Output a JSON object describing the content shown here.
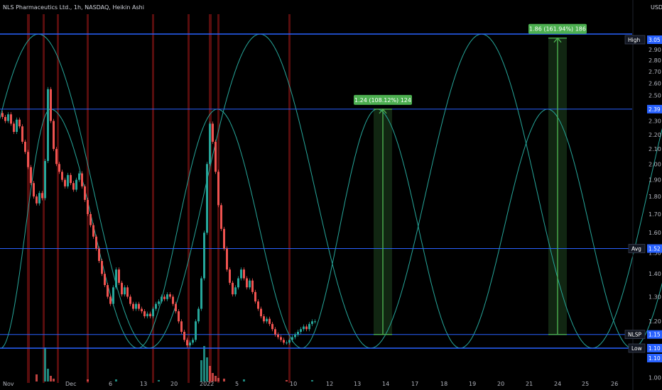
{
  "header": {
    "title": "NLS Pharmaceutics Ltd., 1h, NASDAQ, Heikin Ashi",
    "currency": "USD"
  },
  "colors": {
    "background": "#000000",
    "axis_text": "#b2b5be",
    "level_line": "#2962ff",
    "wave": "#26a69a",
    "up_candle": "#26a69a",
    "down_candle": "#ef5350",
    "measure": "#4caf50",
    "volume_up": "#26a69a",
    "volume_down": "#ef5350",
    "session_band": "#a01818"
  },
  "chart_data": {
    "type": "candlestick",
    "chart_style": "Heikin Ashi",
    "interval": "1h",
    "exchange": "NASDAQ",
    "y_scale": "log",
    "ylim": [
      0.98,
      3.3
    ],
    "y_ticks": [
      1.0,
      1.1,
      1.2,
      1.3,
      1.4,
      1.5,
      1.6,
      1.7,
      1.8,
      1.9,
      2.0,
      2.1,
      2.2,
      2.3,
      2.4,
      2.5,
      2.6,
      2.7,
      2.8,
      2.9,
      3.0,
      3.05
    ],
    "y_tick_labels": [
      "1.00",
      "1.10",
      "1.20",
      "1.30",
      "1.40",
      "1.50",
      "1.60",
      "1.70",
      "1.80",
      "1.90",
      "2.00",
      "2.10",
      "2.20",
      "2.30",
      "2.40",
      "2.50",
      "2.60",
      "2.70",
      "2.80",
      "2.90",
      "3.00",
      "3.05"
    ],
    "x_ticks": [
      {
        "label": "Nov",
        "bar": 0
      },
      {
        "label": "Dec",
        "bar": 88
      },
      {
        "label": "6",
        "bar": 149
      },
      {
        "label": "13",
        "bar": 193
      },
      {
        "label": "20",
        "bar": 236
      },
      {
        "label": "2022",
        "bar": 277
      },
      {
        "label": "5",
        "bar": 327
      },
      {
        "label": "10",
        "bar": 404
      },
      {
        "label": "12",
        "bar": 455
      },
      {
        "label": "13",
        "bar": 494
      },
      {
        "label": "14",
        "bar": 534
      },
      {
        "label": "17",
        "bar": 575
      },
      {
        "label": "18",
        "bar": 616
      },
      {
        "label": "19",
        "bar": 656
      },
      {
        "label": "20",
        "bar": 696
      },
      {
        "label": "21",
        "bar": 736
      },
      {
        "label": "24",
        "bar": 776
      },
      {
        "label": "25",
        "bar": 815
      },
      {
        "label": "26",
        "bar": 856
      }
    ],
    "last_bar": 440,
    "horizontal_levels": [
      {
        "label": "High",
        "value": 3.05,
        "price_label": "3.05"
      },
      {
        "label": "",
        "value": 2.39,
        "price_label": "2.39"
      },
      {
        "label": "Avg",
        "value": 1.52,
        "price_label": "1.52"
      },
      {
        "label": "NLSP",
        "value": 1.15,
        "price_label": "1.15"
      },
      {
        "label": "Low",
        "value": 1.1,
        "price_label": "1.10"
      },
      {
        "label": "",
        "value": 1.1,
        "price_label": "1.10"
      }
    ],
    "price_range_measures": [
      {
        "text": "1.24 (108.12%) 124",
        "from_value": 1.15,
        "to_value": 2.39,
        "bar_start": 524,
        "bar_end": 550
      },
      {
        "text": "1.86 (161.94%) 186",
        "from_value": 1.15,
        "to_value": 3.01,
        "bar_start": 770,
        "bar_end": 796
      }
    ],
    "cycle_waves": [
      {
        "name": "",
        "peak_bars": [
          -260,
          52,
          364,
          676,
          988
        ],
        "trough_bars": [
          -104,
          208,
          520,
          832
        ],
        "peak_value": 3.05,
        "trough_value": 1.1
      },
      {
        "name": "",
        "peak_bars": [
          -116,
          69,
          304,
          529,
          769,
          1009
        ],
        "trough_bars": [
          -1,
          192,
          423,
          646,
          888
        ],
        "peak_value": 2.39,
        "trough_value": 1.1
      }
    ],
    "candles": [
      {
        "bar": 0,
        "open": 2.36,
        "close": 2.33
      },
      {
        "bar": 4,
        "open": 2.33,
        "close": 2.3
      },
      {
        "bar": 8,
        "open": 2.3,
        "close": 2.35
      },
      {
        "bar": 12,
        "open": 2.35,
        "close": 2.28
      },
      {
        "bar": 16,
        "open": 2.28,
        "close": 2.22
      },
      {
        "bar": 20,
        "open": 2.22,
        "close": 2.31
      },
      {
        "bar": 24,
        "open": 2.31,
        "close": 2.26
      },
      {
        "bar": 28,
        "open": 2.26,
        "close": 2.15
      },
      {
        "bar": 32,
        "open": 2.15,
        "close": 2.08
      },
      {
        "bar": 36,
        "open": 2.08,
        "close": 1.98
      },
      {
        "bar": 40,
        "open": 1.98,
        "close": 1.88
      },
      {
        "bar": 44,
        "open": 1.88,
        "close": 1.8
      },
      {
        "bar": 48,
        "open": 1.8,
        "close": 1.76
      },
      {
        "bar": 52,
        "open": 1.76,
        "close": 1.82
      },
      {
        "bar": 56,
        "open": 1.82,
        "close": 1.79
      },
      {
        "bar": 60,
        "open": 1.79,
        "close": 2.02
      },
      {
        "bar": 64,
        "open": 2.02,
        "close": 2.55
      },
      {
        "bar": 68,
        "open": 2.55,
        "close": 2.3
      },
      {
        "bar": 72,
        "open": 2.3,
        "close": 2.1
      },
      {
        "bar": 76,
        "open": 2.1,
        "close": 2.0
      },
      {
        "bar": 80,
        "open": 2.0,
        "close": 1.95
      },
      {
        "bar": 84,
        "open": 1.95,
        "close": 1.9
      },
      {
        "bar": 88,
        "open": 1.9,
        "close": 1.86
      },
      {
        "bar": 92,
        "open": 1.86,
        "close": 1.93
      },
      {
        "bar": 96,
        "open": 1.93,
        "close": 1.88
      },
      {
        "bar": 100,
        "open": 1.88,
        "close": 1.84
      },
      {
        "bar": 104,
        "open": 1.84,
        "close": 1.9
      },
      {
        "bar": 108,
        "open": 1.9,
        "close": 1.94
      },
      {
        "bar": 112,
        "open": 1.94,
        "close": 1.86
      },
      {
        "bar": 116,
        "open": 1.86,
        "close": 1.78
      },
      {
        "bar": 120,
        "open": 1.78,
        "close": 1.7
      },
      {
        "bar": 124,
        "open": 1.7,
        "close": 1.64
      },
      {
        "bar": 128,
        "open": 1.64,
        "close": 1.58
      },
      {
        "bar": 132,
        "open": 1.58,
        "close": 1.52
      },
      {
        "bar": 136,
        "open": 1.52,
        "close": 1.46
      },
      {
        "bar": 140,
        "open": 1.46,
        "close": 1.4
      },
      {
        "bar": 144,
        "open": 1.4,
        "close": 1.35
      },
      {
        "bar": 148,
        "open": 1.35,
        "close": 1.3
      },
      {
        "bar": 152,
        "open": 1.3,
        "close": 1.27
      },
      {
        "bar": 156,
        "open": 1.27,
        "close": 1.34
      },
      {
        "bar": 160,
        "open": 1.34,
        "close": 1.42
      },
      {
        "bar": 164,
        "open": 1.42,
        "close": 1.36
      },
      {
        "bar": 168,
        "open": 1.36,
        "close": 1.31
      },
      {
        "bar": 172,
        "open": 1.31,
        "close": 1.34
      },
      {
        "bar": 176,
        "open": 1.34,
        "close": 1.3
      },
      {
        "bar": 180,
        "open": 1.3,
        "close": 1.27
      },
      {
        "bar": 184,
        "open": 1.27,
        "close": 1.25
      },
      {
        "bar": 188,
        "open": 1.25,
        "close": 1.27
      },
      {
        "bar": 192,
        "open": 1.27,
        "close": 1.25
      },
      {
        "bar": 196,
        "open": 1.25,
        "close": 1.24
      },
      {
        "bar": 200,
        "open": 1.24,
        "close": 1.22
      },
      {
        "bar": 204,
        "open": 1.22,
        "close": 1.23
      },
      {
        "bar": 208,
        "open": 1.23,
        "close": 1.22
      },
      {
        "bar": 212,
        "open": 1.22,
        "close": 1.25
      },
      {
        "bar": 216,
        "open": 1.25,
        "close": 1.27
      },
      {
        "bar": 220,
        "open": 1.27,
        "close": 1.28
      },
      {
        "bar": 224,
        "open": 1.28,
        "close": 1.3
      },
      {
        "bar": 228,
        "open": 1.3,
        "close": 1.29
      },
      {
        "bar": 232,
        "open": 1.29,
        "close": 1.31
      },
      {
        "bar": 236,
        "open": 1.31,
        "close": 1.3
      },
      {
        "bar": 240,
        "open": 1.3,
        "close": 1.27
      },
      {
        "bar": 244,
        "open": 1.27,
        "close": 1.24
      },
      {
        "bar": 248,
        "open": 1.24,
        "close": 1.2
      },
      {
        "bar": 252,
        "open": 1.2,
        "close": 1.16
      },
      {
        "bar": 256,
        "open": 1.16,
        "close": 1.13
      },
      {
        "bar": 260,
        "open": 1.13,
        "close": 1.11
      },
      {
        "bar": 264,
        "open": 1.11,
        "close": 1.12
      },
      {
        "bar": 268,
        "open": 1.12,
        "close": 1.13
      },
      {
        "bar": 272,
        "open": 1.13,
        "close": 1.2
      },
      {
        "bar": 276,
        "open": 1.2,
        "close": 1.25
      },
      {
        "bar": 280,
        "open": 1.25,
        "close": 1.38
      },
      {
        "bar": 284,
        "open": 1.38,
        "close": 1.6
      },
      {
        "bar": 288,
        "open": 1.6,
        "close": 2.0
      },
      {
        "bar": 292,
        "open": 2.0,
        "close": 2.28
      },
      {
        "bar": 296,
        "open": 2.28,
        "close": 2.15
      },
      {
        "bar": 300,
        "open": 2.15,
        "close": 1.95
      },
      {
        "bar": 304,
        "open": 1.95,
        "close": 1.75
      },
      {
        "bar": 308,
        "open": 1.75,
        "close": 1.62
      },
      {
        "bar": 312,
        "open": 1.62,
        "close": 1.52
      },
      {
        "bar": 316,
        "open": 1.52,
        "close": 1.42
      },
      {
        "bar": 320,
        "open": 1.42,
        "close": 1.36
      },
      {
        "bar": 324,
        "open": 1.36,
        "close": 1.31
      },
      {
        "bar": 328,
        "open": 1.31,
        "close": 1.34
      },
      {
        "bar": 332,
        "open": 1.34,
        "close": 1.38
      },
      {
        "bar": 336,
        "open": 1.38,
        "close": 1.42
      },
      {
        "bar": 340,
        "open": 1.42,
        "close": 1.38
      },
      {
        "bar": 344,
        "open": 1.38,
        "close": 1.34
      },
      {
        "bar": 348,
        "open": 1.34,
        "close": 1.37
      },
      {
        "bar": 352,
        "open": 1.37,
        "close": 1.32
      },
      {
        "bar": 356,
        "open": 1.32,
        "close": 1.28
      },
      {
        "bar": 360,
        "open": 1.28,
        "close": 1.25
      },
      {
        "bar": 364,
        "open": 1.25,
        "close": 1.22
      },
      {
        "bar": 368,
        "open": 1.22,
        "close": 1.2
      },
      {
        "bar": 372,
        "open": 1.2,
        "close": 1.21
      },
      {
        "bar": 376,
        "open": 1.21,
        "close": 1.19
      },
      {
        "bar": 380,
        "open": 1.19,
        "close": 1.17
      },
      {
        "bar": 384,
        "open": 1.17,
        "close": 1.15
      },
      {
        "bar": 388,
        "open": 1.15,
        "close": 1.14
      },
      {
        "bar": 392,
        "open": 1.14,
        "close": 1.13
      },
      {
        "bar": 396,
        "open": 1.13,
        "close": 1.12
      },
      {
        "bar": 400,
        "open": 1.12,
        "close": 1.12
      },
      {
        "bar": 404,
        "open": 1.12,
        "close": 1.13
      },
      {
        "bar": 408,
        "open": 1.13,
        "close": 1.14
      },
      {
        "bar": 412,
        "open": 1.14,
        "close": 1.15
      },
      {
        "bar": 416,
        "open": 1.15,
        "close": 1.16
      },
      {
        "bar": 420,
        "open": 1.16,
        "close": 1.17
      },
      {
        "bar": 424,
        "open": 1.17,
        "close": 1.18
      },
      {
        "bar": 428,
        "open": 1.18,
        "close": 1.17
      },
      {
        "bar": 432,
        "open": 1.17,
        "close": 1.19
      },
      {
        "bar": 436,
        "open": 1.19,
        "close": 1.2
      },
      {
        "bar": 440,
        "open": 1.2,
        "close": 1.2
      }
    ],
    "volume": [
      {
        "bar": 48,
        "value": 10,
        "up": false
      },
      {
        "bar": 60,
        "value": 48,
        "up": true
      },
      {
        "bar": 64,
        "value": 18,
        "up": true
      },
      {
        "bar": 68,
        "value": 8,
        "up": false
      },
      {
        "bar": 72,
        "value": 4,
        "up": false
      },
      {
        "bar": 120,
        "value": 3,
        "up": false
      },
      {
        "bar": 160,
        "value": 3,
        "up": true
      },
      {
        "bar": 220,
        "value": 2,
        "up": true
      },
      {
        "bar": 280,
        "value": 30,
        "up": true
      },
      {
        "bar": 284,
        "value": 50,
        "up": true
      },
      {
        "bar": 288,
        "value": 34,
        "up": true
      },
      {
        "bar": 292,
        "value": 22,
        "up": false
      },
      {
        "bar": 296,
        "value": 12,
        "up": false
      },
      {
        "bar": 300,
        "value": 8,
        "up": false
      },
      {
        "bar": 304,
        "value": 5,
        "up": false
      },
      {
        "bar": 312,
        "value": 4,
        "up": false
      },
      {
        "bar": 340,
        "value": 3,
        "up": true
      },
      {
        "bar": 400,
        "value": 2,
        "up": false
      },
      {
        "bar": 436,
        "value": 2,
        "up": true
      }
    ],
    "session_bands": [
      {
        "bar": 36,
        "width": 4
      },
      {
        "bar": 58,
        "width": 3
      },
      {
        "bar": 78,
        "width": 3
      },
      {
        "bar": 120,
        "width": 3
      },
      {
        "bar": 212,
        "width": 3
      },
      {
        "bar": 262,
        "width": 3
      },
      {
        "bar": 292,
        "width": 4
      },
      {
        "bar": 304,
        "width": 3
      },
      {
        "bar": 404,
        "width": 3
      }
    ]
  }
}
